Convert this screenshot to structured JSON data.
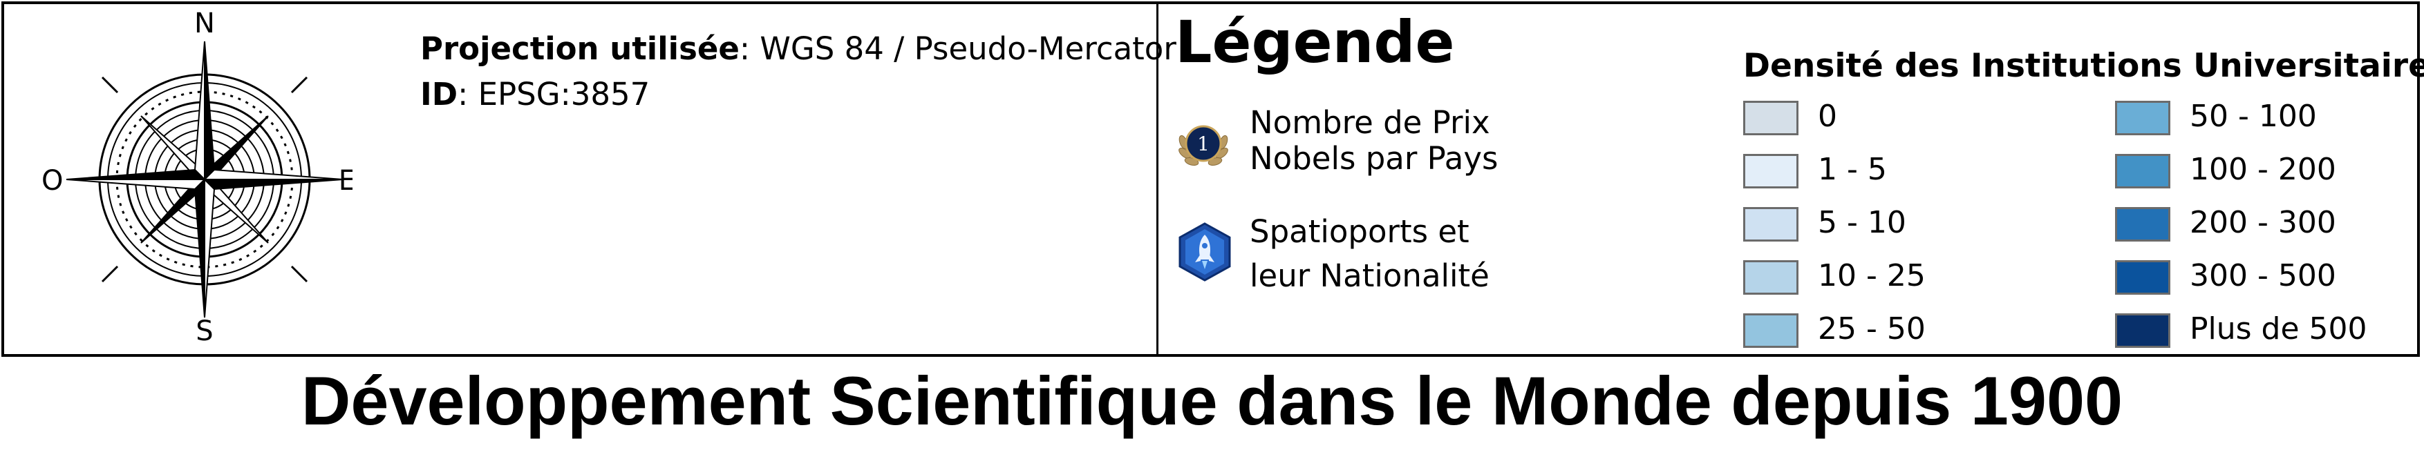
{
  "compass": {
    "north": "N",
    "south": "S",
    "east": "E",
    "west": "O"
  },
  "projection": {
    "label": "Projection utilisée",
    "value": ": WGS 84 / Pseudo-Mercator",
    "id_label": "ID",
    "id_value": ": EPSG:3857"
  },
  "legend": {
    "title": "Légende",
    "symbols": [
      {
        "icon": "nobel-laurel-badge-icon",
        "badge_number": "1",
        "lines": [
          "Nombre de Prix",
          "Nobels par Pays"
        ]
      },
      {
        "icon": "spaceport-rocket-hexagon-icon",
        "lines": [
          "Spatioports et",
          "leur Nationalité"
        ]
      }
    ],
    "density": {
      "title": "Densité des Institutions Universitaires",
      "classes": [
        {
          "label": "0",
          "color": "#d5dfe8"
        },
        {
          "label": "1 - 5",
          "color": "#e3eef9"
        },
        {
          "label": "5 - 10",
          "color": "#cfe1f2"
        },
        {
          "label": "10 - 25",
          "color": "#b5d4e9"
        },
        {
          "label": "25 - 50",
          "color": "#93c4df"
        },
        {
          "label": "50 - 100",
          "color": "#6aaed6"
        },
        {
          "label": "100 - 200",
          "color": "#4292c6"
        },
        {
          "label": "200 - 300",
          "color": "#2271b5"
        },
        {
          "label": "300 - 500",
          "color": "#0b539d"
        },
        {
          "label": "Plus de 500",
          "color": "#08306b"
        }
      ]
    }
  },
  "title": "Développement Scientifique dans le Monde depuis 1900"
}
